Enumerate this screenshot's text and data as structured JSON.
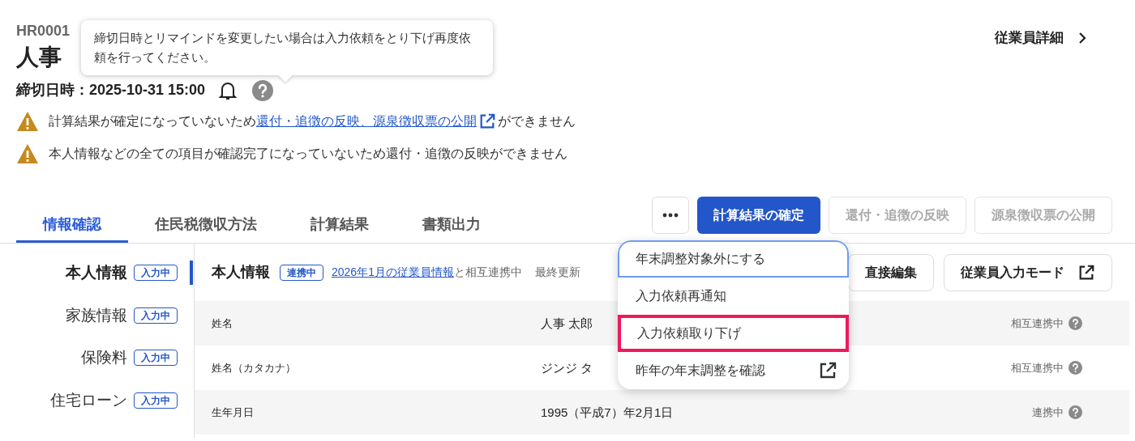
{
  "header": {
    "employee_code": "HR0001",
    "employee_name": "人事",
    "detail_link": "従業員詳細",
    "deadline": "締切日時：2025-10-31 15:00"
  },
  "tooltip": {
    "text": "締切日時とリマインドを変更したい場合は入力依頼をとり下げ再度依頼を行ってください。"
  },
  "warnings": [
    {
      "text": "計算結果が確定になっていないため",
      "link": "還付・追徴の反映、源泉徴収票の公開",
      "after": "ができません"
    },
    {
      "text": "本人情報などの全ての項目が確認完了になっていないため還付・追徴の反映ができません"
    }
  ],
  "tabs": [
    {
      "label": "情報確認",
      "selected": true
    },
    {
      "label": "住民税徴収方法",
      "selected": false
    },
    {
      "label": "計算結果",
      "selected": false
    },
    {
      "label": "書類出力",
      "selected": false
    }
  ],
  "actions": [
    {
      "label": "計算結果の確定",
      "disabled": false
    },
    {
      "label": "還付・追徴の反映",
      "disabled": true
    },
    {
      "label": "源泉徴収票の公開",
      "disabled": true
    }
  ],
  "menu": {
    "items": [
      {
        "label": "年末調整対象外にする",
        "focused": true,
        "highlighted": false,
        "external": false
      },
      {
        "label": "入力依頼再通知",
        "focused": false,
        "highlighted": false,
        "external": false
      },
      {
        "label": "入力依頼取り下げ",
        "focused": false,
        "highlighted": true,
        "external": false
      },
      {
        "label": "昨年の年末調整を確認",
        "focused": false,
        "highlighted": false,
        "external": true
      }
    ]
  },
  "sidebar": {
    "items": [
      {
        "label": "本人情報",
        "badge": "入力中",
        "selected": true
      },
      {
        "label": "家族情報",
        "badge": "入力中",
        "selected": false
      },
      {
        "label": "保険料",
        "badge": "入力中",
        "selected": false
      },
      {
        "label": "住宅ローン",
        "badge": "入力中",
        "selected": false
      }
    ]
  },
  "section": {
    "title": "本人情報",
    "badge": "連携中",
    "link": "2026年1月の従業員情報",
    "link_suffix": "と相互連携中",
    "updated": "最終更新",
    "buttons": [
      {
        "label": "直接編集",
        "external": false
      },
      {
        "label": "従業員入力モード",
        "external": true
      }
    ]
  },
  "rows": [
    {
      "label": "姓名",
      "value": "人事 太郎",
      "status": "相互連携中"
    },
    {
      "label": "姓名（カタカナ）",
      "value": "ジンジ タ",
      "status": "相互連携中"
    },
    {
      "label": "生年月日",
      "value": "1995（平成7）年2月1日",
      "status": "連携中"
    }
  ]
}
